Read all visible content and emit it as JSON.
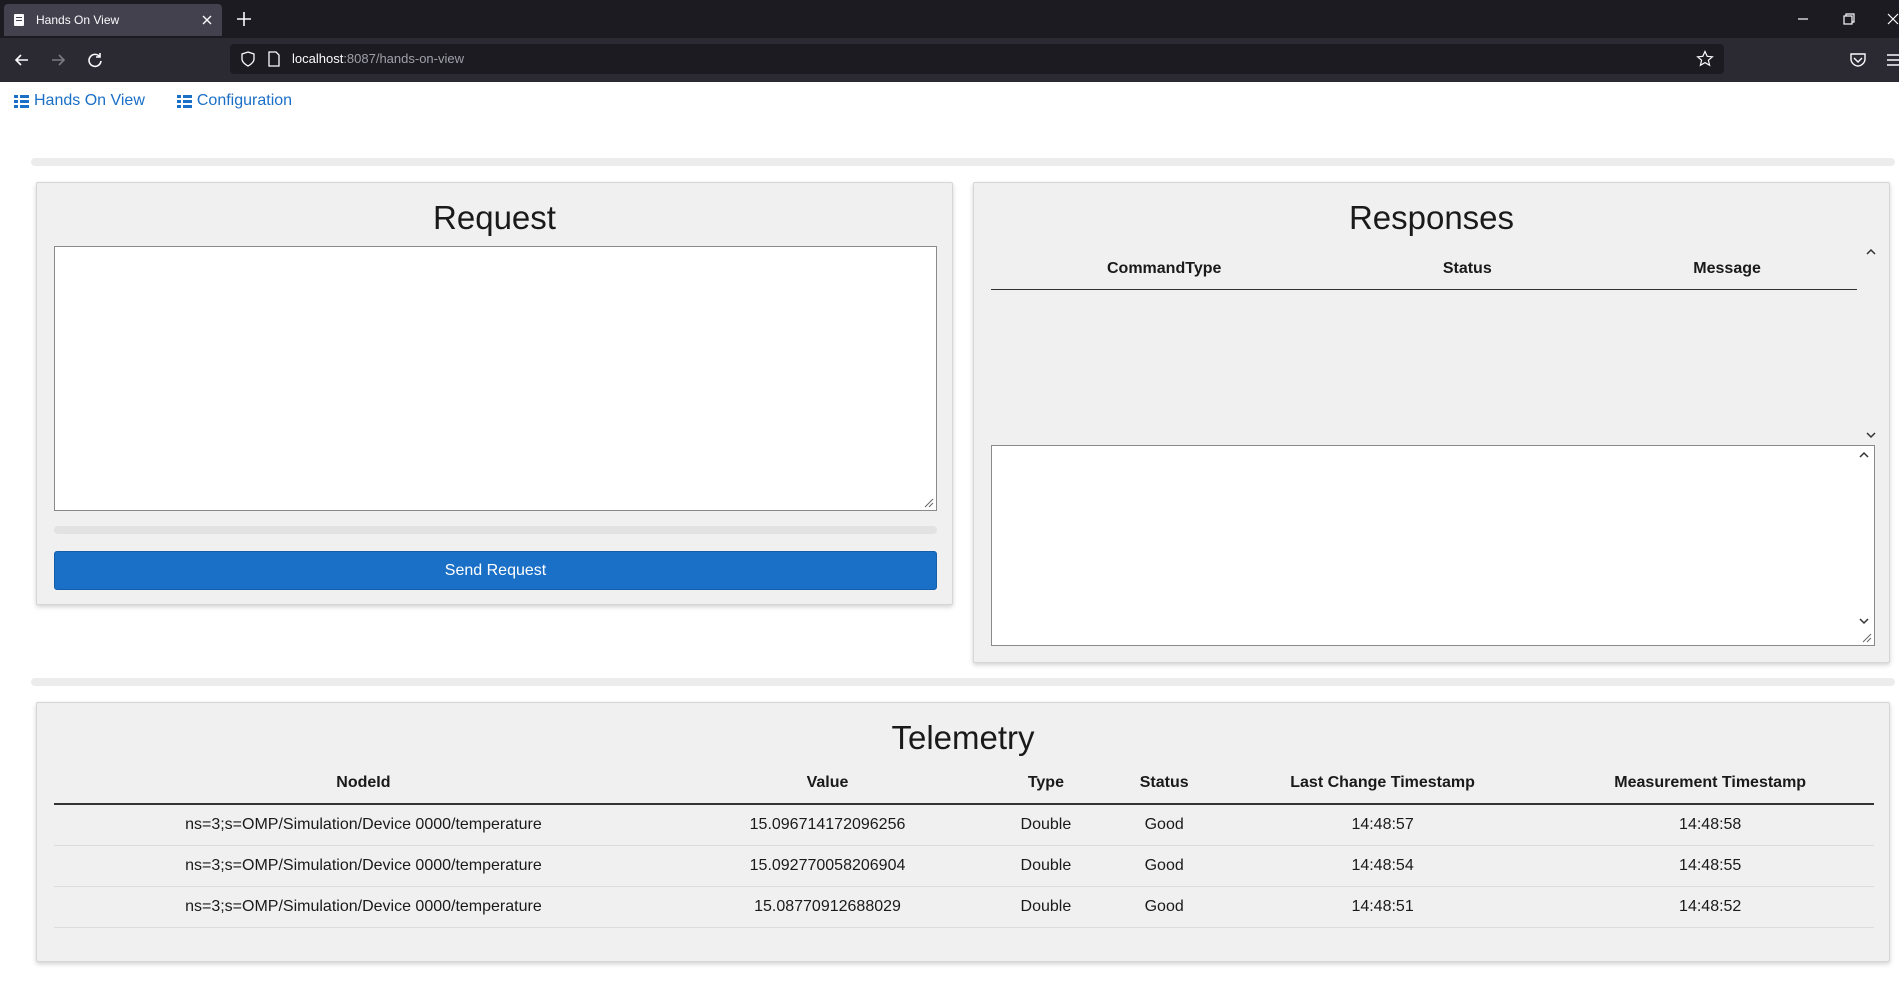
{
  "browser": {
    "tab_title": "Hands On View",
    "url_host": "localhost",
    "url_rest": ":8087/hands-on-view"
  },
  "nav": {
    "hands_on_view": "Hands On View",
    "configuration": "Configuration"
  },
  "request": {
    "title": "Request",
    "value": "",
    "send_label": "Send Request"
  },
  "responses": {
    "title": "Responses",
    "columns": [
      "CommandType",
      "Status",
      "Message"
    ],
    "rows": [],
    "detail_value": ""
  },
  "telemetry": {
    "title": "Telemetry",
    "columns": [
      "NodeId",
      "Value",
      "Type",
      "Status",
      "Last Change Timestamp",
      "Measurement Timestamp"
    ],
    "rows": [
      [
        "ns=3;s=OMP/Simulation/Device 0000/temperature",
        "15.096714172096256",
        "Double",
        "Good",
        "14:48:57",
        "14:48:58"
      ],
      [
        "ns=3;s=OMP/Simulation/Device 0000/temperature",
        "15.092770058206904",
        "Double",
        "Good",
        "14:48:54",
        "14:48:55"
      ],
      [
        "ns=3;s=OMP/Simulation/Device 0000/temperature",
        "15.08770912688029",
        "Double",
        "Good",
        "14:48:51",
        "14:48:52"
      ]
    ]
  },
  "colors": {
    "accent": "#1a6fc7",
    "panel_bg": "#f0f0f0",
    "chrome_dark": "#1c1b22"
  }
}
